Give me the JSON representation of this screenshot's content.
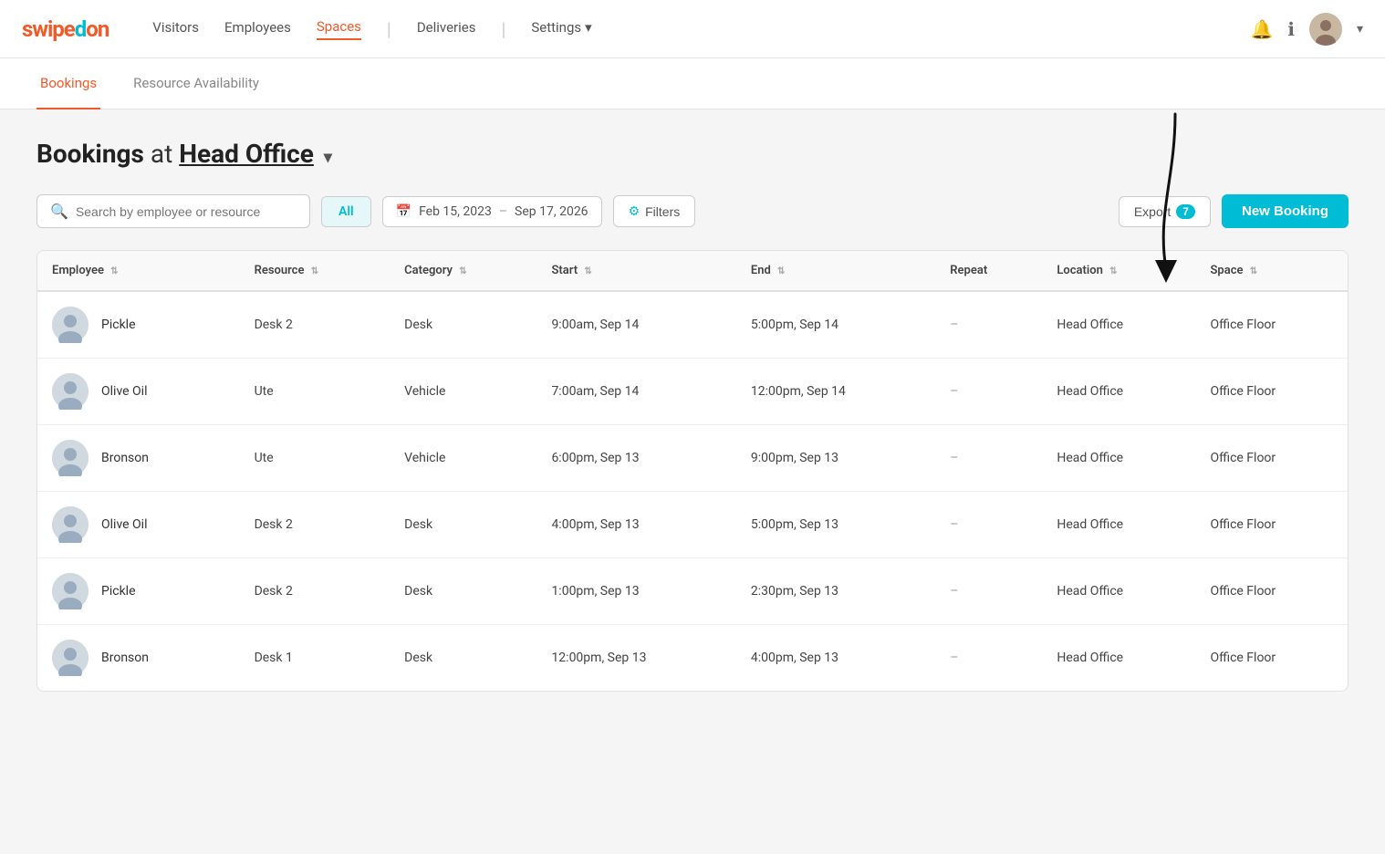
{
  "logo": {
    "text": "swipedon"
  },
  "nav": {
    "links": [
      {
        "id": "visitors",
        "label": "Visitors",
        "active": false
      },
      {
        "id": "employees",
        "label": "Employees",
        "active": false
      },
      {
        "id": "spaces",
        "label": "Spaces",
        "active": true
      },
      {
        "id": "deliveries",
        "label": "Deliveries",
        "active": false
      },
      {
        "id": "settings",
        "label": "Settings",
        "active": false
      }
    ],
    "notification_icon": "🔔",
    "info_icon": "ℹ"
  },
  "tabs": [
    {
      "id": "bookings",
      "label": "Bookings",
      "active": true
    },
    {
      "id": "resource-availability",
      "label": "Resource Availability",
      "active": false
    }
  ],
  "page": {
    "title_prefix": "Bookings",
    "title_at": "at",
    "location": "Head Office"
  },
  "toolbar": {
    "search_placeholder": "Search by employee or resource",
    "filter_tabs": [
      {
        "id": "all",
        "label": "All",
        "active": true
      }
    ],
    "date_start": "Feb 15, 2023",
    "date_end": "Sep 17, 2026",
    "filters_label": "Filters",
    "export_label": "Export",
    "export_count": "7",
    "new_booking_label": "New Booking"
  },
  "table": {
    "columns": [
      {
        "id": "employee",
        "label": "Employee"
      },
      {
        "id": "resource",
        "label": "Resource"
      },
      {
        "id": "category",
        "label": "Category"
      },
      {
        "id": "start",
        "label": "Start"
      },
      {
        "id": "end",
        "label": "End"
      },
      {
        "id": "repeat",
        "label": "Repeat"
      },
      {
        "id": "location",
        "label": "Location"
      },
      {
        "id": "space",
        "label": "Space"
      }
    ],
    "rows": [
      {
        "employee": "Pickle",
        "resource": "Desk 2",
        "category": "Desk",
        "start": "9:00am, Sep 14",
        "end": "5:00pm, Sep 14",
        "repeat": "–",
        "location": "Head Office",
        "space": "Office Floor"
      },
      {
        "employee": "Olive Oil",
        "resource": "Ute",
        "category": "Vehicle",
        "start": "7:00am, Sep 14",
        "end": "12:00pm, Sep 14",
        "repeat": "–",
        "location": "Head Office",
        "space": "Office Floor"
      },
      {
        "employee": "Bronson",
        "resource": "Ute",
        "category": "Vehicle",
        "start": "6:00pm, Sep 13",
        "end": "9:00pm, Sep 13",
        "repeat": "–",
        "location": "Head Office",
        "space": "Office Floor"
      },
      {
        "employee": "Olive Oil",
        "resource": "Desk 2",
        "category": "Desk",
        "start": "4:00pm, Sep 13",
        "end": "5:00pm, Sep 13",
        "repeat": "–",
        "location": "Head Office",
        "space": "Office Floor"
      },
      {
        "employee": "Pickle",
        "resource": "Desk 2",
        "category": "Desk",
        "start": "1:00pm, Sep 13",
        "end": "2:30pm, Sep 13",
        "repeat": "–",
        "location": "Head Office",
        "space": "Office Floor"
      },
      {
        "employee": "Bronson",
        "resource": "Desk 1",
        "category": "Desk",
        "start": "12:00pm, Sep 13",
        "end": "4:00pm, Sep 13",
        "repeat": "–",
        "location": "Head Office",
        "space": "Office Floor"
      }
    ]
  }
}
